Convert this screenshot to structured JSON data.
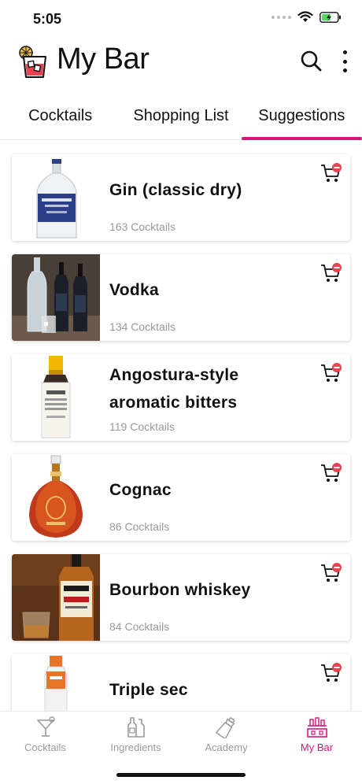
{
  "status_bar": {
    "time": "5:05"
  },
  "header": {
    "title": "My Bar"
  },
  "tabs": [
    {
      "label": "Cocktails",
      "active": false
    },
    {
      "label": "Shopping List",
      "active": false
    },
    {
      "label": "Suggestions",
      "active": true
    }
  ],
  "ingredients": [
    {
      "name": "Gin (classic dry)",
      "count": "163 Cocktails",
      "icon": "gin-bottle"
    },
    {
      "name": "Vodka",
      "count": "134 Cocktails",
      "icon": "vodka-bottles"
    },
    {
      "name": "Angostura-style aromatic bitters",
      "count": "119 Cocktails",
      "icon": "bitters-bottle"
    },
    {
      "name": "Cognac",
      "count": "86 Cocktails",
      "icon": "cognac-bottle"
    },
    {
      "name": "Bourbon whiskey",
      "count": "84 Cocktails",
      "icon": "bourbon-bottle"
    },
    {
      "name": "Triple sec",
      "count": "",
      "icon": "triple-sec-bottle"
    }
  ],
  "bottom_nav": [
    {
      "label": "Cocktails",
      "icon": "cocktail-glass-icon",
      "active": false
    },
    {
      "label": "Ingredients",
      "icon": "bottles-icon",
      "active": false
    },
    {
      "label": "Academy",
      "icon": "shaker-icon",
      "active": false
    },
    {
      "label": "My Bar",
      "icon": "bar-icon",
      "active": true
    }
  ],
  "colors": {
    "accent": "#d6157a",
    "muted_text": "#9a9a9a",
    "cart_badge": "#e8434f"
  }
}
